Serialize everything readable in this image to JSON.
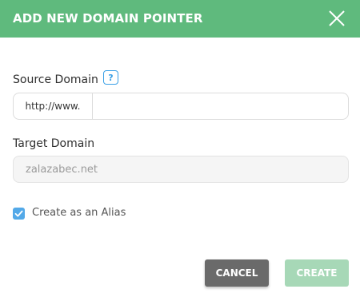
{
  "dialog": {
    "title": "ADD NEW DOMAIN POINTER",
    "accent_color": "#5fba7d"
  },
  "source": {
    "label": "Source Domain",
    "help": "?",
    "prefix": "http://www.",
    "value": ""
  },
  "target": {
    "label": "Target Domain",
    "value": "zalazabec.net"
  },
  "alias": {
    "label": "Create as an Alias",
    "checked": true
  },
  "buttons": {
    "cancel": "CANCEL",
    "create": "CREATE"
  },
  "icons": {
    "close": "close-icon",
    "check": "check-icon"
  }
}
